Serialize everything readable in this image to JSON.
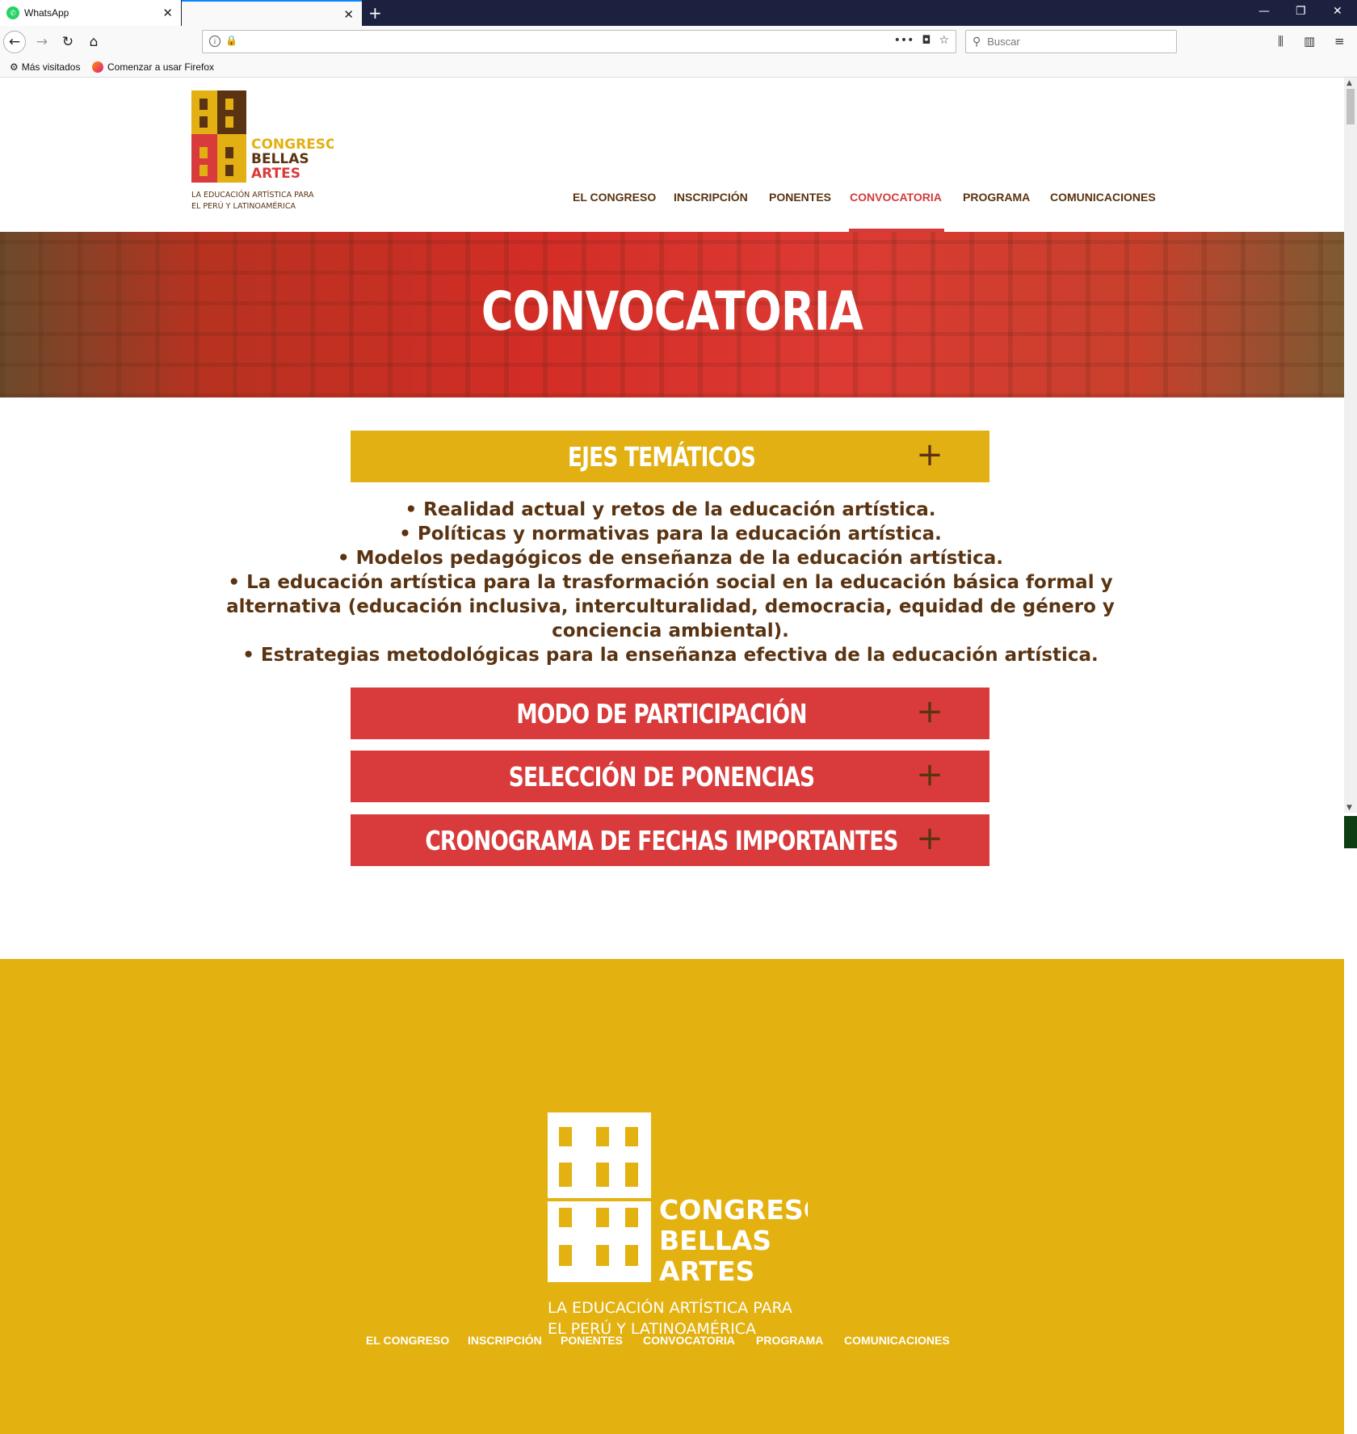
{
  "browser": {
    "tabs": [
      {
        "title": "WhatsApp"
      },
      {
        "title": ""
      }
    ],
    "url": "",
    "search_placeholder": "Buscar",
    "bookmarks": [
      {
        "label": "Más visitados"
      },
      {
        "label": "Comenzar a usar Firefox"
      }
    ]
  },
  "site": {
    "logo": {
      "line1": "CONGRESO",
      "line2": "BELLAS",
      "line3": "ARTES",
      "tagline1": "LA EDUCACIÓN ARTÍSTICA PARA",
      "tagline2": "EL PERÚ Y LATINOAMÉRICA"
    },
    "nav": [
      {
        "label": "EL CONGRESO"
      },
      {
        "label": "INSCRIPCIÓN"
      },
      {
        "label": "PONENTES"
      },
      {
        "label": "CONVOCATORIA",
        "active": true
      },
      {
        "label": "PROGRAMA"
      },
      {
        "label": "COMUNICACIONES"
      }
    ],
    "hero_title": "CONVOCATORIA",
    "sections": [
      {
        "title": "EJES TEMÁTICOS",
        "icon": "plus-icon",
        "color": "#e2b012",
        "expanded": true
      },
      {
        "title": "MODO DE PARTICIPACIÓN",
        "icon": "plus-icon",
        "color": "#d93a3b"
      },
      {
        "title": "SELECCIÓN DE PONENCIAS",
        "icon": "plus-icon",
        "color": "#d93a3b"
      },
      {
        "title": "CRONOGRAMA DE FECHAS IMPORTANTES",
        "icon": "plus-icon",
        "color": "#d93a3b"
      }
    ],
    "ejes": [
      "• Realidad actual y retos de la educación artística.",
      "• Políticas y normativas para la educación artística.",
      "• Modelos pedagógicos de enseñanza de la educación artística.",
      "• La educación artística para la trasformación social en la educación básica formal y",
      "alternativa (educación inclusiva, interculturalidad, democracia, equidad de género y",
      "conciencia ambiental).",
      "• Estrategias metodológicas para la enseñanza efectiva de la educación artística."
    ],
    "footer_nav": [
      {
        "label": "EL CONGRESO"
      },
      {
        "label": "INSCRIPCIÓN"
      },
      {
        "label": "PONENTES"
      },
      {
        "label": "CONVOCATORIA"
      },
      {
        "label": "PROGRAMA"
      },
      {
        "label": "COMUNICACIONES"
      }
    ],
    "colors": {
      "brown": "#5a3412",
      "red": "#d93a3b",
      "yellow": "#e2b012",
      "footer": "#e3b211"
    }
  }
}
